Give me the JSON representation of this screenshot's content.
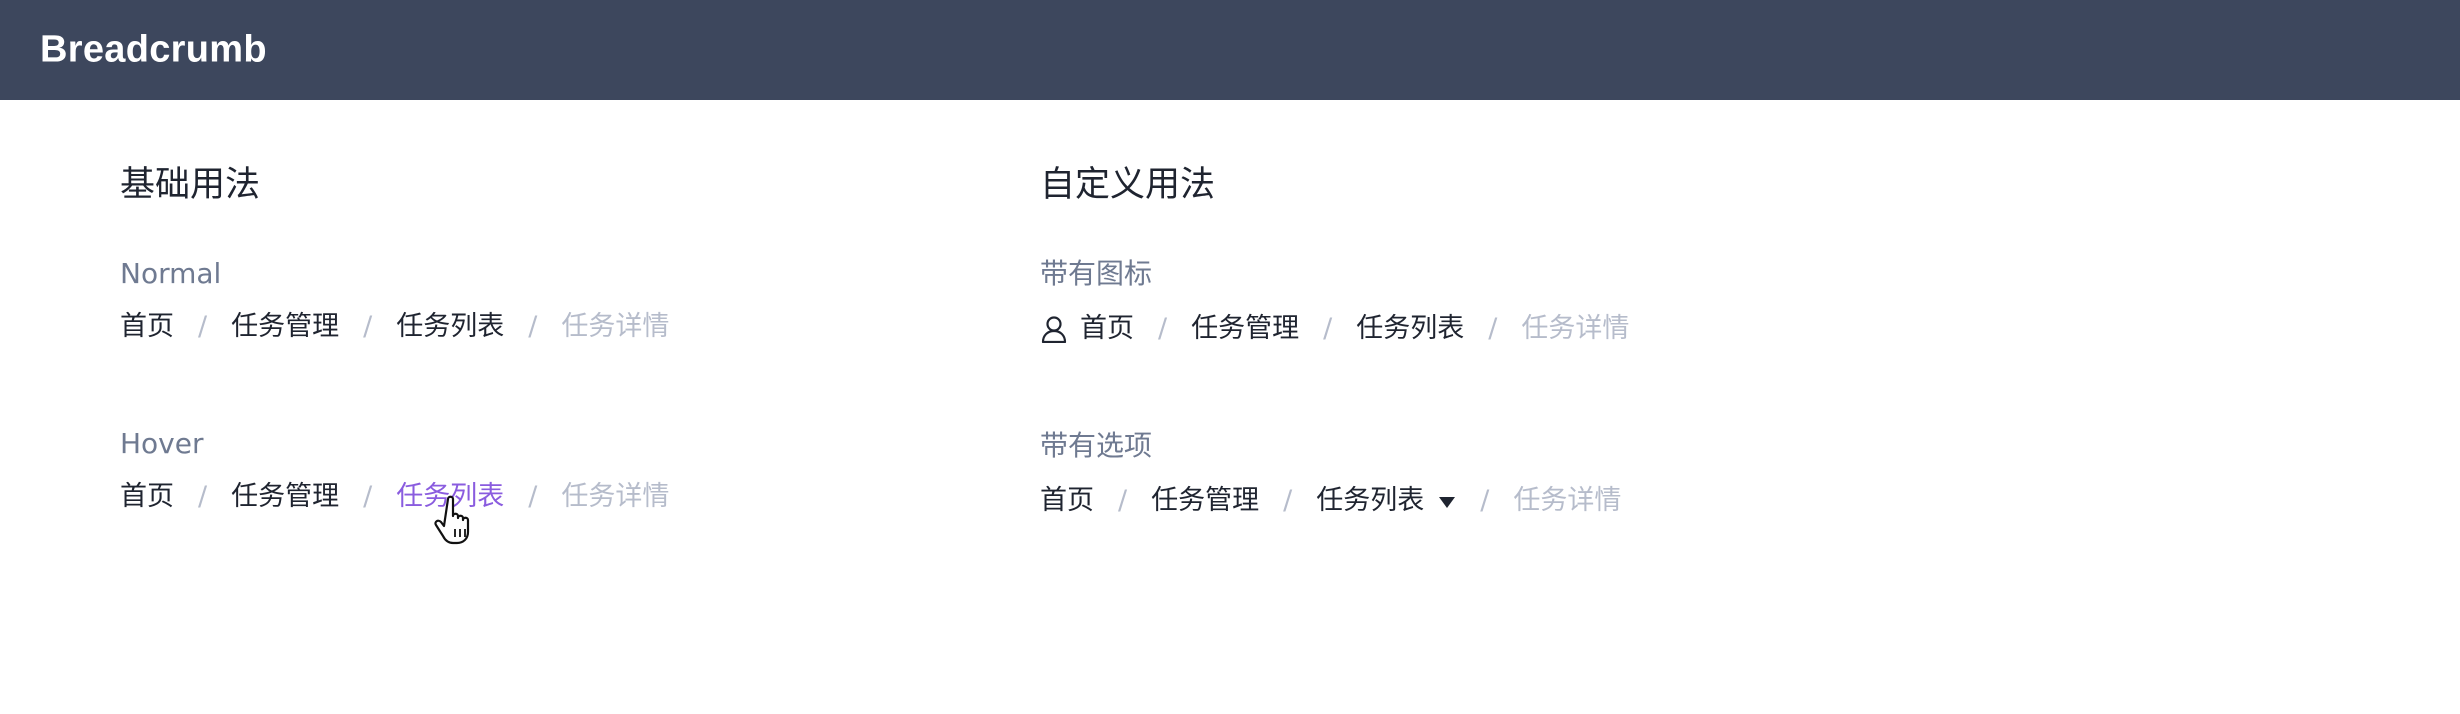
{
  "header": {
    "title": "Breadcrumb"
  },
  "basic": {
    "title": "基础用法",
    "normal": {
      "label": "Normal",
      "items": [
        "首页",
        "任务管理",
        "任务列表",
        "任务详情"
      ],
      "separator": "/"
    },
    "hover": {
      "label": "Hover",
      "items": [
        "首页",
        "任务管理",
        "任务列表",
        "任务详情"
      ],
      "separator": "/",
      "hovered_index": 2
    }
  },
  "custom": {
    "title": "自定义用法",
    "with_icon": {
      "label": "带有图标",
      "icon": "user-icon",
      "items": [
        "首页",
        "任务管理",
        "任务列表",
        "任务详情"
      ],
      "separator": "/"
    },
    "with_options": {
      "label": "带有选项",
      "items": [
        "首页",
        "任务管理",
        "任务列表",
        "任务详情"
      ],
      "separator": "/",
      "dropdown_index": 2,
      "dropdown_icon": "caret-down-icon"
    }
  },
  "colors": {
    "header_bg": "#3d475d",
    "text": "#1f2430",
    "muted": "#6f7a91",
    "disabled": "#b6bccb",
    "hover": "#8a5cdf"
  }
}
